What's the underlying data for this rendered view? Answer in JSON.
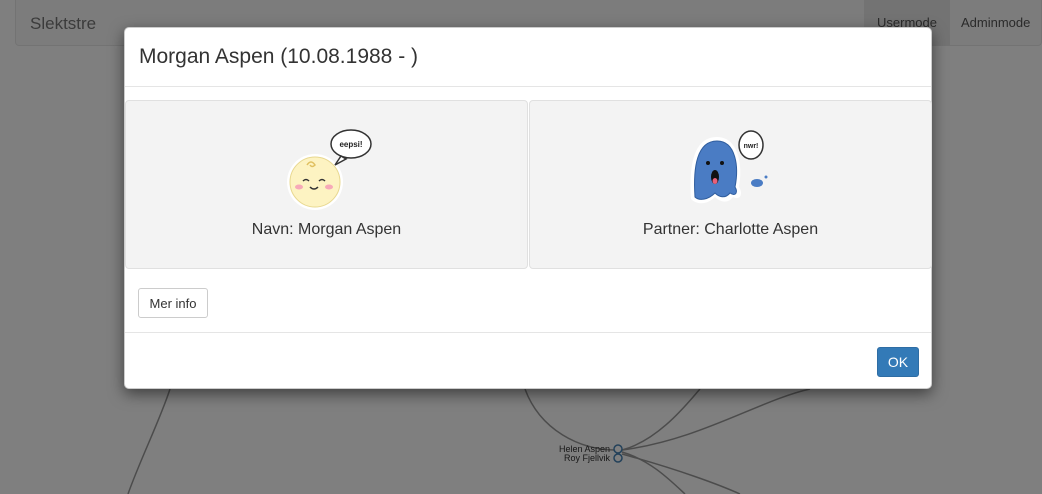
{
  "navbar": {
    "brand": "Slektstre",
    "usermode": "Usermode",
    "adminmode": "Adminmode"
  },
  "tree": {
    "label_1": "Helen Aspen",
    "label_2": "Roy Fjellvik"
  },
  "modal": {
    "title": "Morgan Aspen (10.08.1988 - )",
    "person_label": "Navn: Morgan Aspen",
    "partner_label": "Partner: Charlotte Aspen",
    "person_bubble": "eepsi!",
    "partner_bubble": "nwr!",
    "more_info_button": "Mer info",
    "ok_button": "OK"
  },
  "colors": {
    "primary": "#337ab7",
    "backdrop": "rgba(0,0,0,0.5)",
    "ghost": "#4a7cc4"
  }
}
